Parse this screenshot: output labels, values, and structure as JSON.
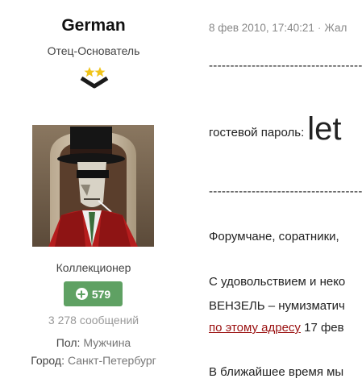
{
  "user": {
    "name": "German",
    "title": "Отец-Основатель",
    "group": "Коллекционер",
    "reputation": "579",
    "post_count": "3 278 сообщений",
    "gender_label": "Пол:",
    "gender_value": "Мужчина",
    "city_label": "Город:",
    "city_value": "Санкт-Петербург",
    "rank_icon": "two-stars-chevron",
    "colors": {
      "reputation_badge": "#5fa163",
      "stars": "#f0c419"
    }
  },
  "post": {
    "date": "8 фев 2010, 17:40:21",
    "separator": "·",
    "report": "Жал",
    "dashes": "----------------------------------------------",
    "guest_label": "гостевой пароль:",
    "guest_password": "let",
    "p1": "Форумчане, соратники,",
    "p2_line1": "С удовольствием и неко",
    "p2_line2": "ВЕНЗЕЛЬ – нумизматич",
    "p2_link": "по этому адресу",
    "p2_after_link": " 17 фев",
    "p3": "В ближайшее время мы",
    "p4": "…",
    "link_color": "#9a1010"
  }
}
